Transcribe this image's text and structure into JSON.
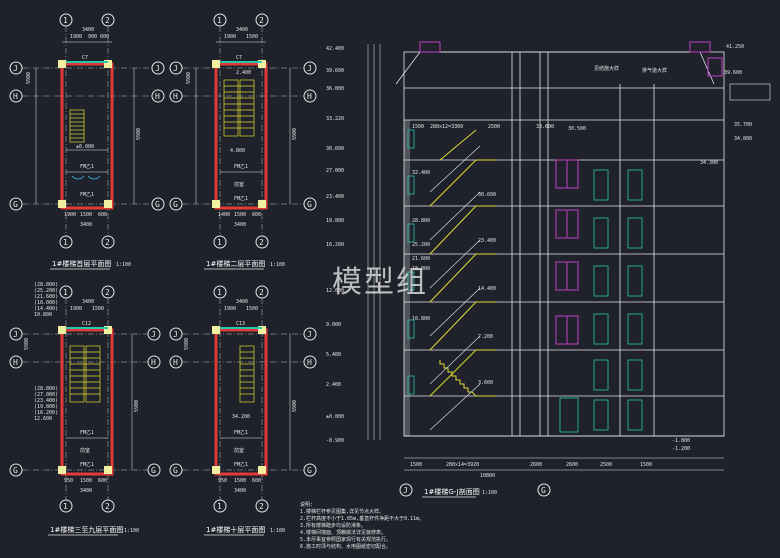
{
  "watermark": "模型组",
  "plans": [
    {
      "id": "plan1",
      "title": "1#楼梯首层平面图",
      "scale": "1:100",
      "top_axes": [
        "1",
        "2"
      ],
      "side_axes": [
        "J",
        "H",
        "G"
      ],
      "top_dims": [
        "3400",
        "1900",
        "900",
        "600"
      ],
      "overall_width": "3400",
      "overall_height": "5900",
      "labels": [
        "C7",
        "FM乙1",
        "FM乙1"
      ],
      "elevation": "±0.000",
      "bottom_dims": [
        "1900",
        "1500",
        "600",
        "3400"
      ]
    },
    {
      "id": "plan2",
      "title": "1#楼梯二层平面图",
      "scale": "1:100",
      "top_axes": [
        "1",
        "2"
      ],
      "side_axes": [
        "J",
        "H",
        "G"
      ],
      "top_dims": [
        "3400",
        "1900",
        "1500"
      ],
      "overall_width": "3400",
      "overall_height": "5900",
      "labels": [
        "C7",
        "FM乙1",
        "前室",
        "FM乙1"
      ],
      "elevation": "4.800",
      "elevation2": "2.400",
      "bottom_dims": [
        "1400",
        "1500",
        "600",
        "3400"
      ]
    },
    {
      "id": "plan3",
      "title": "1#楼梯三至九层平面图",
      "scale": "1:100",
      "top_axes": [
        "1",
        "2"
      ],
      "side_axes": [
        "J",
        "H",
        "G"
      ],
      "top_dims": [
        "3400",
        "1900",
        "1500"
      ],
      "overall_width": "3400",
      "overall_height": "5900",
      "labels": [
        "C12",
        "FM乙1",
        "前室",
        "FM乙1"
      ],
      "elevation_stack": [
        "(28.800)",
        "(25.200)",
        "(21.600)",
        "(18.000)",
        "(14.400)",
        "10.800"
      ],
      "side_elevations": [
        "(28.800)",
        "(27.000)",
        "(23.400)",
        "(19.800)",
        "(16.200)",
        "12.600"
      ],
      "bottom_dims": [
        "950",
        "1500",
        "600",
        "3400"
      ]
    },
    {
      "id": "plan4",
      "title": "1#楼梯十层平面图",
      "scale": "1:100",
      "top_axes": [
        "1",
        "2"
      ],
      "side_axes": [
        "J",
        "H",
        "G"
      ],
      "top_dims": [
        "3400",
        "1900",
        "1500"
      ],
      "overall_width": "3400",
      "overall_height": "5900",
      "labels": [
        "C13",
        "FM乙1",
        "前室",
        "FM乙1"
      ],
      "elevation": "34.200",
      "bottom_dims": [
        "950",
        "1500",
        "600",
        "3400"
      ]
    }
  ],
  "section": {
    "title": "1#楼梯G-J剖面图",
    "scale": "1:100",
    "bottom_axes": [
      "J",
      "G"
    ],
    "left_elevations": [
      "42.400",
      "39.600",
      "36.000",
      "33.220",
      "30.600",
      "27.000",
      "23.400",
      "19.800",
      "16.200",
      "12.600",
      "9.000",
      "5.400",
      "2.400",
      "±0.000",
      "-0.900"
    ],
    "right_elevations": [
      "41.250",
      "39.600",
      "35.700",
      "34.800",
      "34.300",
      "30.500",
      "-1.800",
      "-1.200"
    ],
    "stair_elevations": [
      "32.400",
      "30.600",
      "28.800",
      "25.200",
      "23.400",
      "21.600",
      "18.000",
      "14.400",
      "10.800",
      "7.200",
      "3.600"
    ],
    "bottom_dims": [
      "1500",
      "280x14=3920",
      "2600",
      "2600",
      "2500",
      "1500",
      "10800"
    ],
    "top_dims": [
      "1500",
      "280x12=3360",
      "2500",
      "33.600"
    ],
    "note_texts": [
      "见结施大样",
      "排气道大样"
    ],
    "notes_header": "说明:",
    "notes": [
      "1.楼梯栏杆参见图集,详见节点大样。",
      "2.栏杆高度不小于1.05m,垂直杆件净距不大于0.11m。",
      "3.所有楼梯踏步均设防滑条。",
      "4.楼梯间墙面、顶棚做法详见装修表。",
      "5.未尽事宜参照国家现行有关规范执行。",
      "6.施工时须与结构、水电图纸密切配合。"
    ]
  },
  "colors": {
    "background": "#1f222b",
    "wall": "#e23a3a",
    "stair": "#e0d830",
    "window": "#26c6b0",
    "line": "#e6e6e6",
    "dim": "#e6e6e6",
    "section_frame": "#e6e6e6",
    "accent_purple": "#c040c0",
    "door": "#3ad0ff"
  }
}
